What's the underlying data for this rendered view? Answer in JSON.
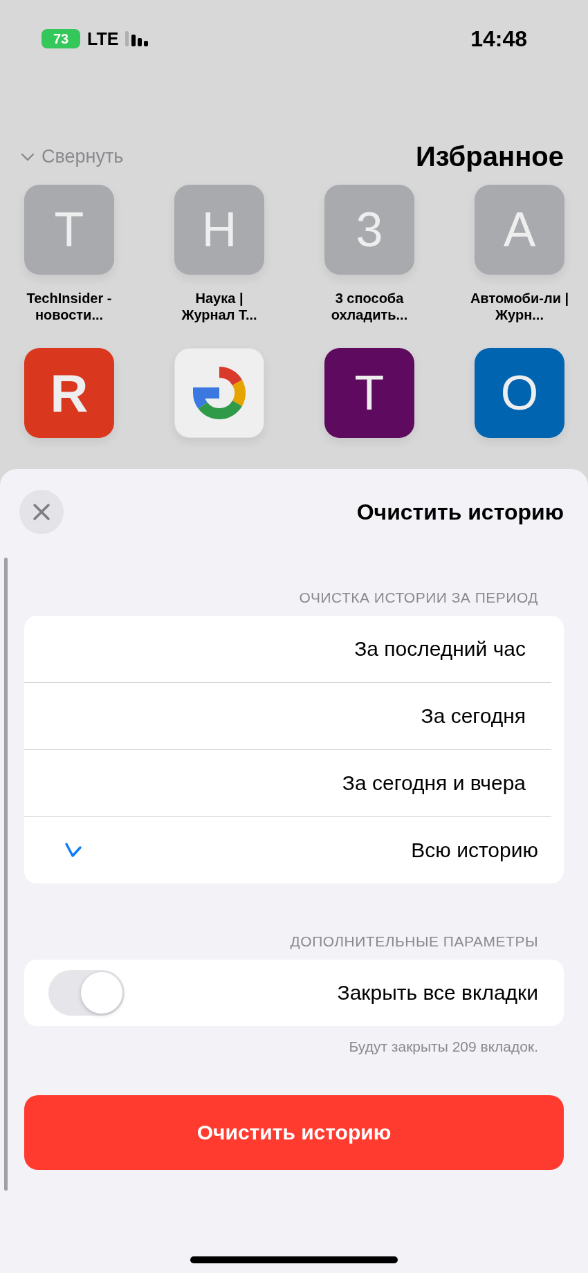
{
  "status_bar": {
    "time": "14:48",
    "network": "LTE",
    "battery": "73"
  },
  "favorites": {
    "title": "Избранное",
    "collapse": "Свернуть",
    "items": [
      {
        "letter": "T",
        "label": "TechInsider - новости...",
        "color": "#a9aaae"
      },
      {
        "letter": "Н",
        "label": "Наука | Журнал Т...",
        "color": "#a9aaae"
      },
      {
        "letter": "3",
        "label": "3 способа охладить...",
        "color": "#a9aaae"
      },
      {
        "letter": "А",
        "label": "Автомоби-ли | Журн...",
        "color": "#a9aaae"
      },
      {
        "kind": "letter",
        "letter": "R",
        "color": "#d9381e"
      },
      {
        "kind": "google",
        "color": "#efeff0"
      },
      {
        "kind": "letter",
        "letter": "T",
        "color": "#5e0a5e"
      },
      {
        "kind": "letter",
        "letter": "O",
        "color": "#0064b0"
      }
    ]
  },
  "sheet": {
    "title": "Очистить историю",
    "period_header": "ОЧИСТКА ИСТОРИИ ЗА ПЕРИОД",
    "periods": [
      {
        "label": "За последний час",
        "selected": false
      },
      {
        "label": "За сегодня",
        "selected": false
      },
      {
        "label": "За сегодня и вчера",
        "selected": false
      },
      {
        "label": "Всю историю",
        "selected": true
      }
    ],
    "options_header": "ДОПОЛНИТЕЛЬНЫЕ ПАРАМЕТРЫ",
    "close_tabs": {
      "label": "Закрыть все вкладки",
      "on": false
    },
    "note": "Будут закрыты 209 вкладок.",
    "button": "Очистить историю"
  }
}
